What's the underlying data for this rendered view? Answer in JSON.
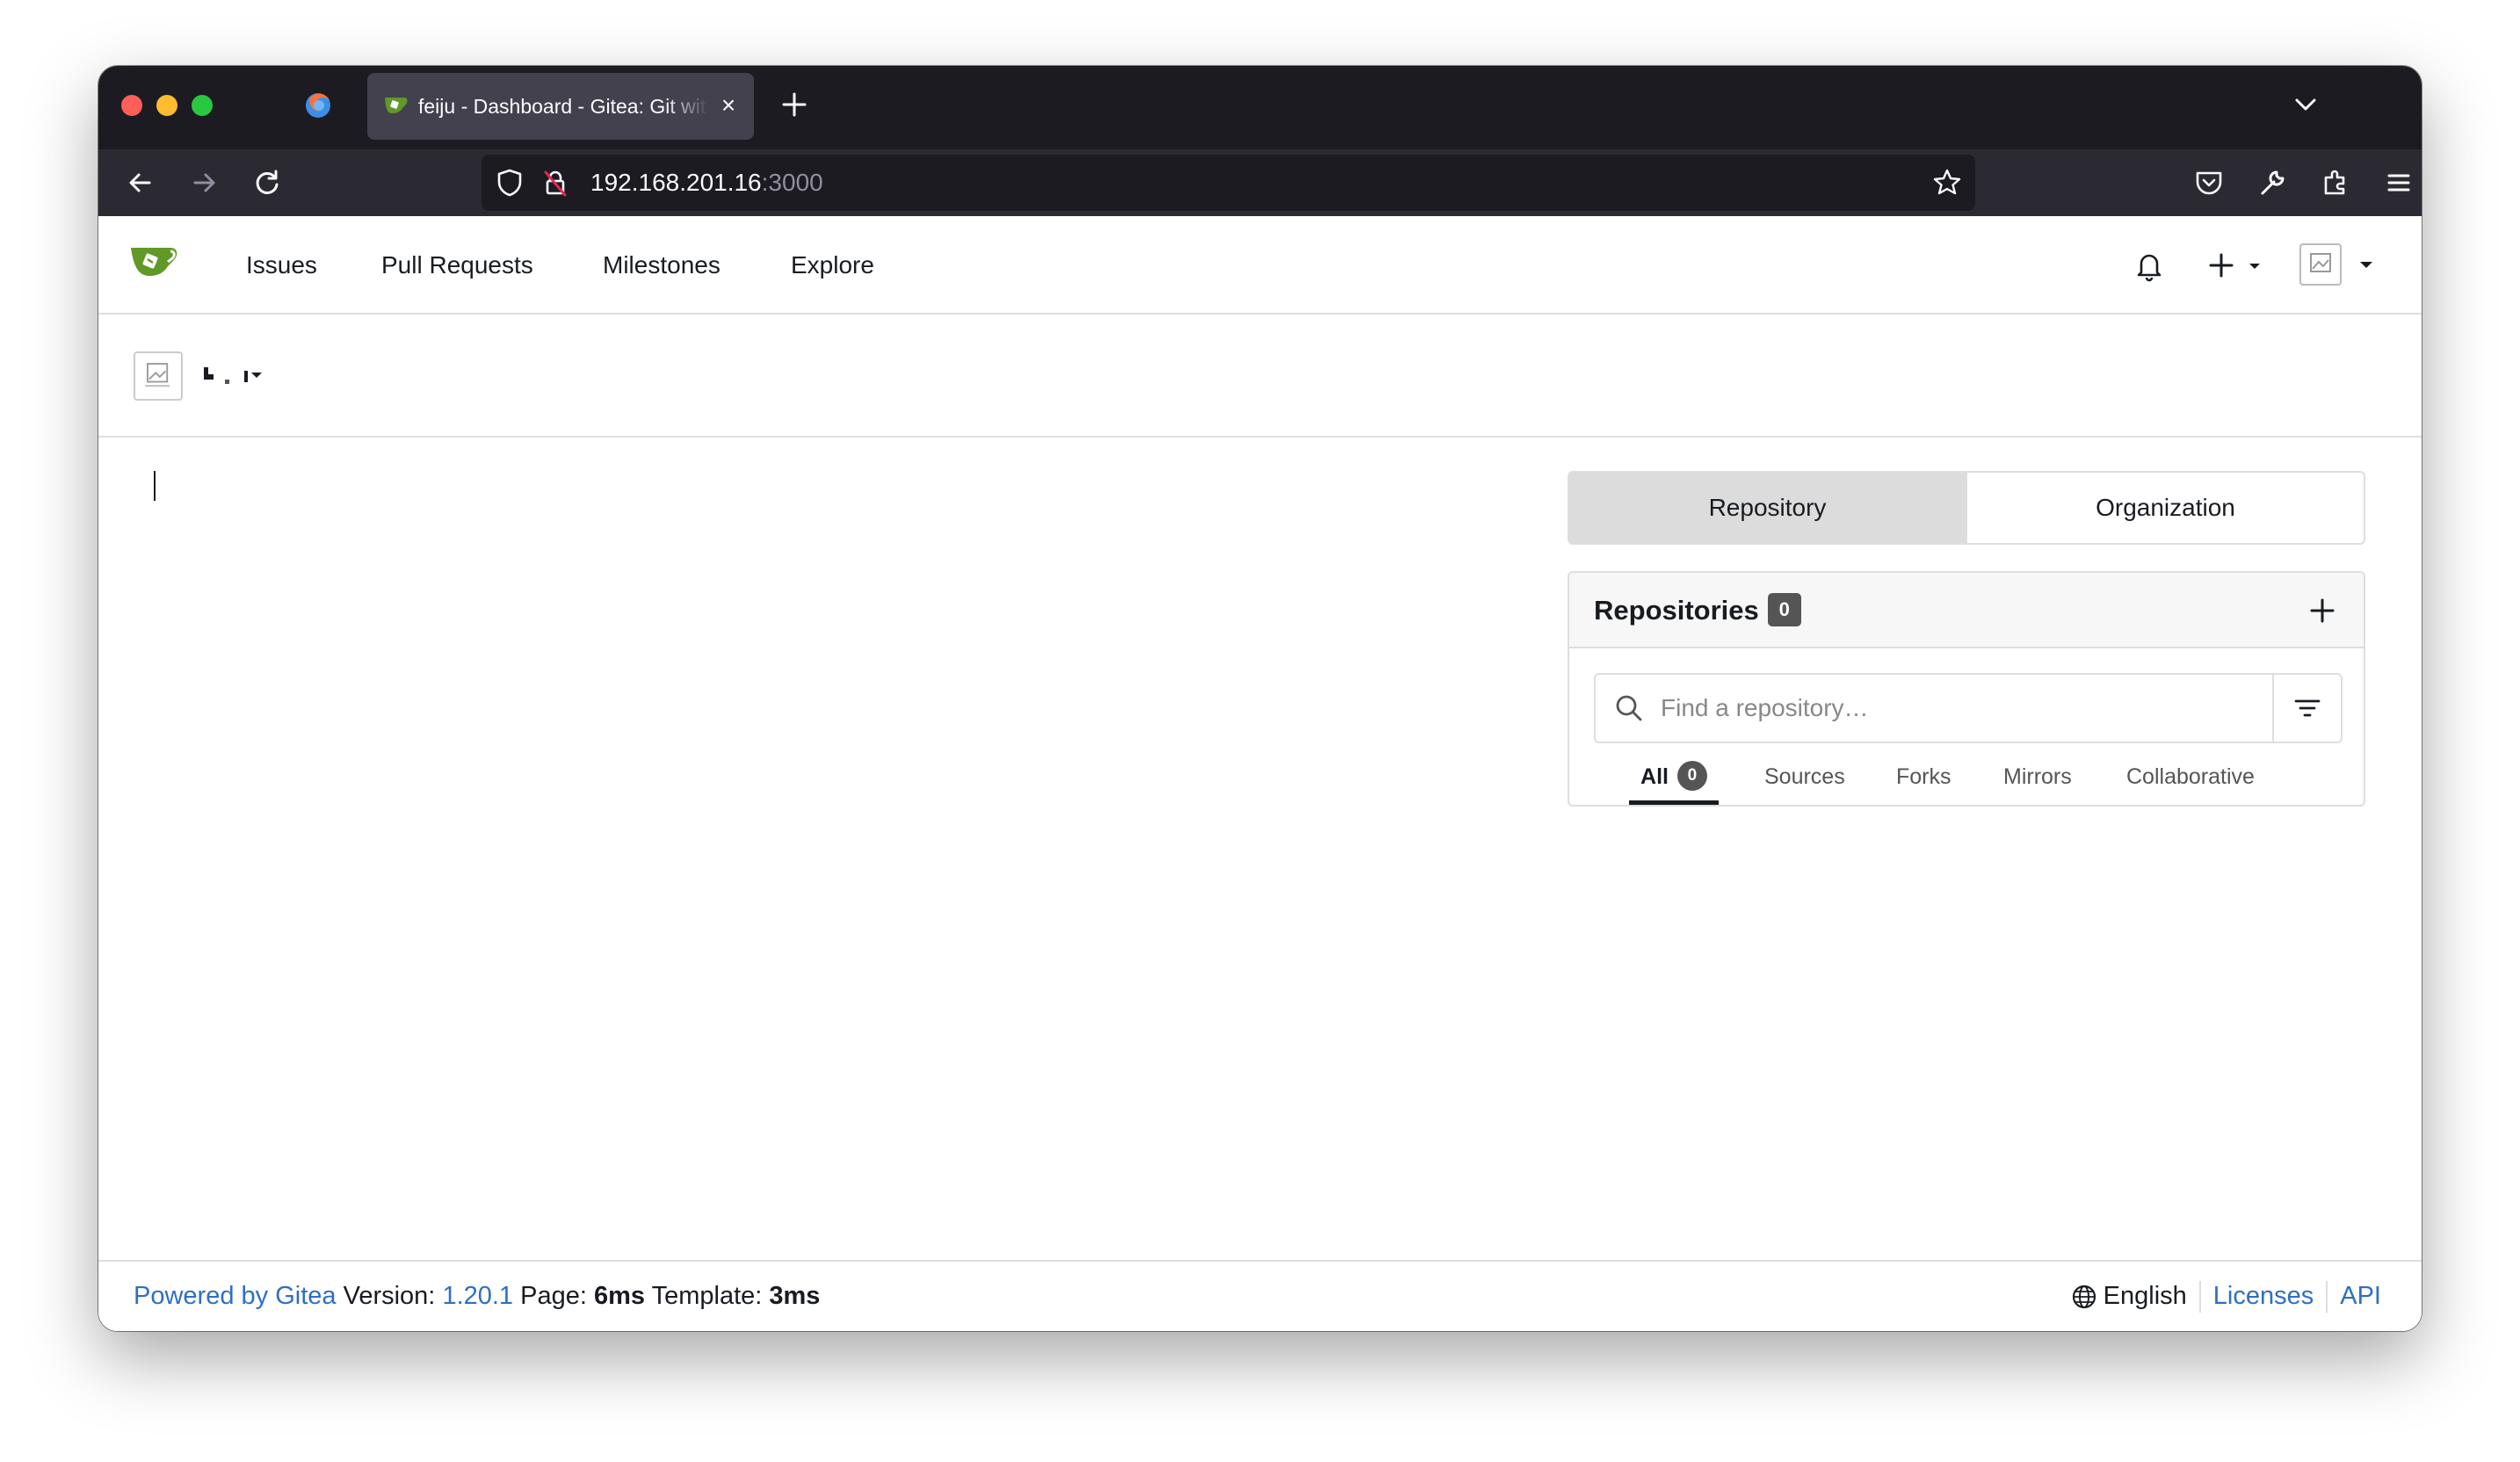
{
  "browser": {
    "tab_title": "feiju - Dashboard - Gitea: Git with a cup of tea",
    "url_host": "192.168.201.16",
    "url_port": ":3000"
  },
  "nav": {
    "items": [
      {
        "label": "Issues"
      },
      {
        "label": "Pull Requests"
      },
      {
        "label": "Milestones"
      },
      {
        "label": "Explore"
      }
    ]
  },
  "switcher": {
    "tabs": [
      {
        "label": "Repository",
        "active": true
      },
      {
        "label": "Organization",
        "active": false
      }
    ]
  },
  "repos": {
    "title": "Repositories",
    "count": "0",
    "search_placeholder": "Find a repository…",
    "filters": [
      {
        "label": "All",
        "count": "0",
        "active": true
      },
      {
        "label": "Sources"
      },
      {
        "label": "Forks"
      },
      {
        "label": "Mirrors"
      },
      {
        "label": "Collaborative"
      }
    ]
  },
  "footer": {
    "powered_by": "Powered by Gitea",
    "version_label": "Version:",
    "version": "1.20.1",
    "page_label": "Page:",
    "page_time": "6ms",
    "template_label": "Template:",
    "template_time": "3ms",
    "language": "English",
    "licenses": "Licenses",
    "api": "API"
  },
  "colors": {
    "accent_link": "#2e6fc2",
    "gitea_green": "#609926",
    "browser_dark": "#1c1b22"
  }
}
